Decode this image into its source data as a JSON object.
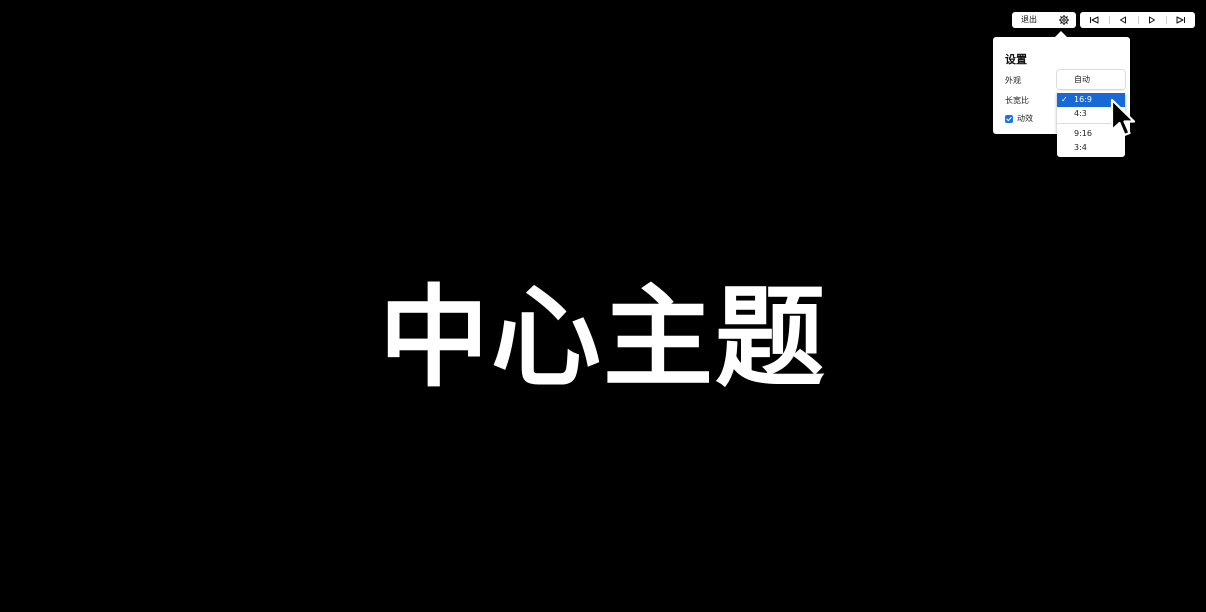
{
  "slide": {
    "title": "中心主题"
  },
  "toolbar": {
    "exit_label": "退出",
    "settings_icon": "gear-icon",
    "nav_icons": [
      "first-slide-icon",
      "previous-slide-icon",
      "next-slide-icon",
      "last-slide-icon"
    ]
  },
  "settings": {
    "title": "设置",
    "appearance_label": "外观",
    "appearance_value": "自动",
    "aspect_ratio_label": "长宽比",
    "animation_label": "动效",
    "animation_checked": true,
    "aspect_ratio_options": [
      "16:9",
      "4:3",
      "9:16",
      "3:4"
    ],
    "aspect_ratio_selected": "16:9"
  },
  "colors": {
    "background": "#000000",
    "accent": "#1868d6",
    "panel": "#ffffff"
  }
}
